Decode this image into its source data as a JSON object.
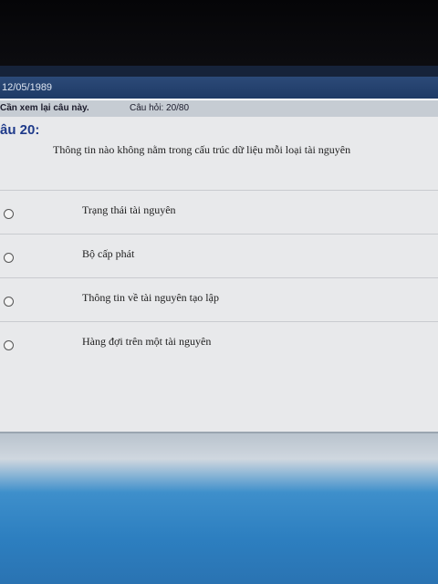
{
  "header": {
    "date": "12/05/1989"
  },
  "info_bar": {
    "review_flag": "Cần xem lại câu này.",
    "question_counter": "Câu hỏi: 20/80"
  },
  "question": {
    "title": "âu 20:",
    "text": "Thông tin nào không nằm trong cấu trúc dữ liệu mỗi loại tài nguyên"
  },
  "answers": [
    {
      "label": "Trạng thái tài nguyên"
    },
    {
      "label": "Bộ cấp phát"
    },
    {
      "label": "Thông tin về tài nguyên tạo lập"
    },
    {
      "label": "Hàng đợi trên một tài nguyên"
    }
  ]
}
